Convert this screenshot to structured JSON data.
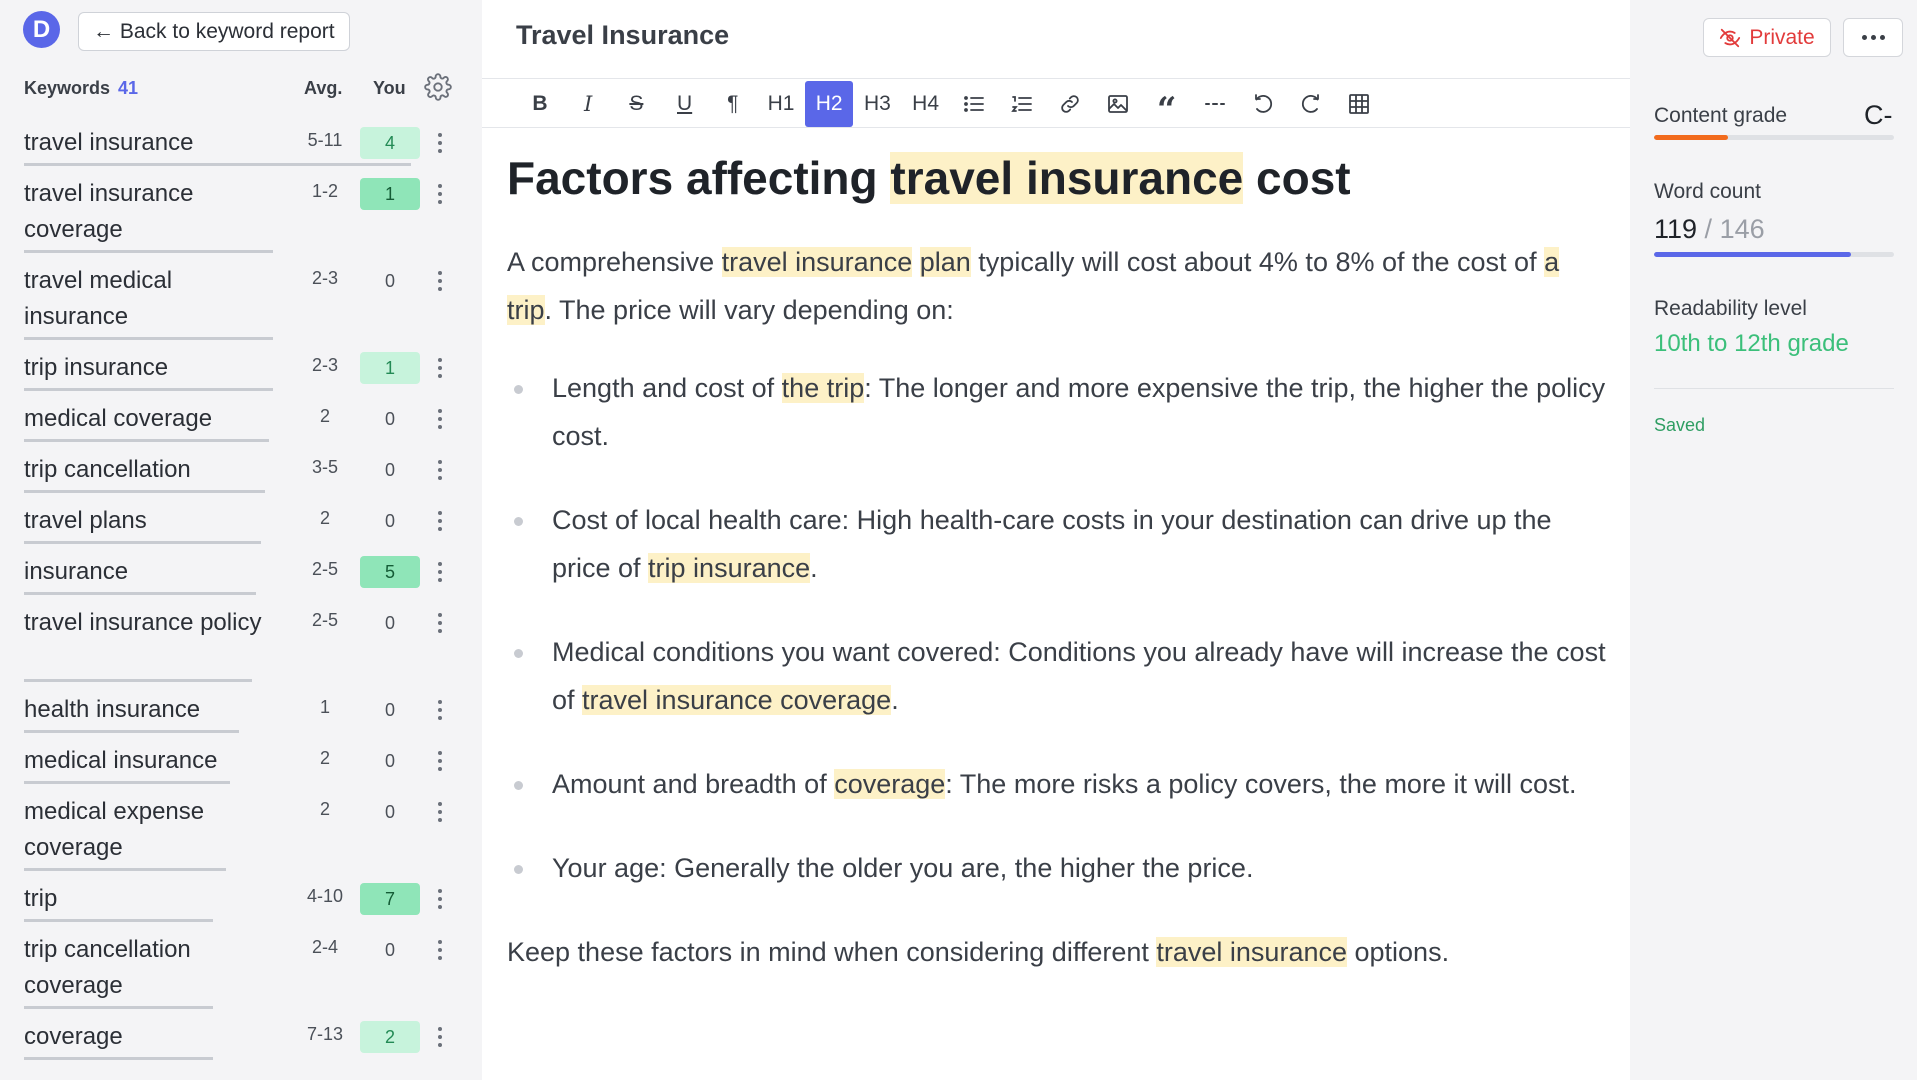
{
  "sidebar": {
    "logo_letter": "D",
    "back_label": "← Back to keyword report",
    "keywords_title": "Keywords",
    "keywords_count": "41",
    "avg_header": "Avg.",
    "you_header": "You",
    "keywords": [
      {
        "term": "travel insurance",
        "avg": "5-11",
        "you": "4",
        "hit": true,
        "bar": 0.9,
        "lines": 1
      },
      {
        "term": "travel insurance coverage",
        "avg": "1-2",
        "you": "1",
        "hit": true,
        "strong": true,
        "bar": 0.58,
        "lines": 2
      },
      {
        "term": "travel medical insurance",
        "avg": "2-3",
        "you": "0",
        "hit": false,
        "bar": 0.58,
        "lines": 2
      },
      {
        "term": "trip insurance",
        "avg": "2-3",
        "you": "1",
        "hit": true,
        "bar": 0.58,
        "lines": 1
      },
      {
        "term": "medical coverage",
        "avg": "2",
        "you": "0",
        "hit": false,
        "bar": 0.57,
        "lines": 1
      },
      {
        "term": "trip cancellation",
        "avg": "3-5",
        "you": "0",
        "hit": false,
        "bar": 0.56,
        "lines": 1
      },
      {
        "term": "travel plans",
        "avg": "2",
        "you": "0",
        "hit": false,
        "bar": 0.55,
        "lines": 1
      },
      {
        "term": "insurance",
        "avg": "2-5",
        "you": "5",
        "hit": true,
        "strong": true,
        "bar": 0.54,
        "lines": 1
      },
      {
        "term": "travel insurance policy",
        "avg": "2-5",
        "you": "0",
        "hit": false,
        "bar": 0.53,
        "lines": 2
      },
      {
        "term": "health insurance",
        "avg": "1",
        "you": "0",
        "hit": false,
        "bar": 0.5,
        "lines": 1
      },
      {
        "term": "medical insurance",
        "avg": "2",
        "you": "0",
        "hit": false,
        "bar": 0.48,
        "lines": 1
      },
      {
        "term": "medical expense coverage",
        "avg": "2",
        "you": "0",
        "hit": false,
        "bar": 0.47,
        "lines": 2
      },
      {
        "term": "trip",
        "avg": "4-10",
        "you": "7",
        "hit": true,
        "strong": true,
        "bar": 0.44,
        "lines": 1
      },
      {
        "term": "trip cancellation coverage",
        "avg": "2-4",
        "you": "0",
        "hit": false,
        "bar": 0.44,
        "lines": 2
      },
      {
        "term": "coverage",
        "avg": "7-13",
        "you": "2",
        "hit": true,
        "bar": 0.44,
        "lines": 1
      }
    ]
  },
  "editor": {
    "doc_title": "Travel Insurance",
    "toolbar": [
      {
        "name": "bold",
        "label": "B",
        "active": false
      },
      {
        "name": "italic",
        "label": "I",
        "active": false
      },
      {
        "name": "strikethrough",
        "label": "S",
        "active": false
      },
      {
        "name": "underline",
        "label": "U",
        "active": false
      },
      {
        "name": "paragraph",
        "label": "¶",
        "active": false
      },
      {
        "name": "h1",
        "label": "H1",
        "active": false
      },
      {
        "name": "h2",
        "label": "H2",
        "active": true
      },
      {
        "name": "h3",
        "label": "H3",
        "active": false
      },
      {
        "name": "h4",
        "label": "H4",
        "active": false
      },
      {
        "name": "bullet-list",
        "label": "",
        "active": false
      },
      {
        "name": "ordered-list",
        "label": "",
        "active": false
      },
      {
        "name": "link",
        "label": "",
        "active": false
      },
      {
        "name": "image",
        "label": "",
        "active": false
      },
      {
        "name": "quote",
        "label": "“",
        "active": false
      },
      {
        "name": "horizontal-rule",
        "label": "",
        "active": false
      },
      {
        "name": "undo",
        "label": "",
        "active": false
      },
      {
        "name": "redo",
        "label": "",
        "active": false
      },
      {
        "name": "table",
        "label": "",
        "active": false
      }
    ],
    "heading": [
      {
        "t": "Factors affecting "
      },
      {
        "t": "travel insurance",
        "hl": true
      },
      {
        "t": " cost"
      }
    ],
    "intro": [
      {
        "t": "A comprehensive "
      },
      {
        "t": "travel insurance",
        "hl": true
      },
      {
        "t": " "
      },
      {
        "t": "plan",
        "hl": true
      },
      {
        "t": " typically will cost about 4% to 8% of the cost of "
      },
      {
        "t": "a trip",
        "hl": true
      },
      {
        "t": ". The price will vary depending on:"
      }
    ],
    "bullets": [
      [
        {
          "t": "Length and cost of "
        },
        {
          "t": "the trip",
          "hl": true
        },
        {
          "t": ": The longer and more expensive the trip, the higher the policy cost."
        }
      ],
      [
        {
          "t": "Cost of local health care: High health-care costs in your destination can drive up the price of "
        },
        {
          "t": "trip insurance",
          "hl": true
        },
        {
          "t": "."
        }
      ],
      [
        {
          "t": "Medical conditions you want covered: Conditions you already have will increase the cost of "
        },
        {
          "t": "travel insurance coverage",
          "hl": true
        },
        {
          "t": "."
        }
      ],
      [
        {
          "t": "Amount and breadth of "
        },
        {
          "t": "coverage",
          "hl": true
        },
        {
          "t": ": The more risks a policy covers, the more it will cost."
        }
      ],
      [
        {
          "t": "Your age: Generally the older you are, the higher the price."
        }
      ]
    ],
    "outro": [
      {
        "t": "Keep these factors in mind when considering different "
      },
      {
        "t": "travel insurance",
        "hl": true
      },
      {
        "t": " options."
      }
    ]
  },
  "panel": {
    "private_label": "Private",
    "content_grade_label": "Content grade",
    "content_grade": "C-",
    "content_grade_progress": 0.31,
    "content_grade_color": "#f26b1d",
    "word_count_label": "Word count",
    "word_count": "119",
    "word_count_sep": " / ",
    "word_count_target": "146",
    "word_count_progress": 0.82,
    "word_count_color": "#5a67e8",
    "readability_label": "Readability level",
    "readability": "10th to 12th grade",
    "saved_label": "Saved"
  }
}
